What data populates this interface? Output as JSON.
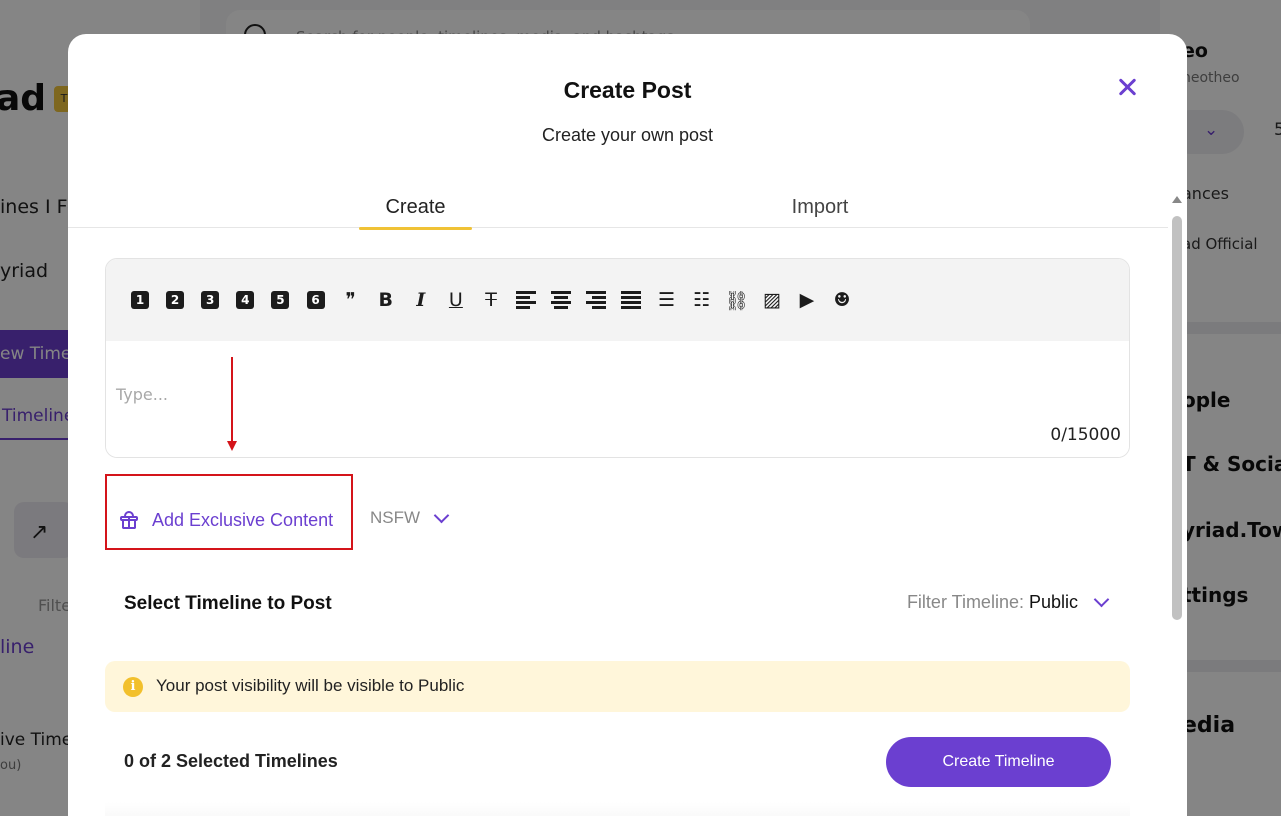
{
  "background": {
    "search_placeholder": "Search for people, timelines, media, and hashtags",
    "brand": "ad",
    "brand_badge": "T",
    "left_items": {
      "timelines_label": "ines I Fo",
      "myriad_label": "yriad",
      "new_timeline_button": "ew Time",
      "timeline_tab": "Timeline",
      "filter_label": "Filte",
      "line_label": "line",
      "exclusive_timeline": "ive Time",
      "you_label": "ou)"
    },
    "right_items": {
      "profile_name": "eo",
      "profile_handle": "neotheo",
      "balances": "ances",
      "official": "ad Official",
      "people": "ople",
      "social": "T & Social",
      "town": "yriad.Town",
      "settings": "ttings",
      "media": "edia",
      "count": "5"
    }
  },
  "modal": {
    "title": "Create Post",
    "subtitle": "Create your own post",
    "tabs": [
      {
        "label": "Create",
        "active": true
      },
      {
        "label": "Import",
        "active": false
      }
    ],
    "editor": {
      "toolbar": [
        {
          "name": "heading-1-icon",
          "glyph": "1",
          "kind": "box"
        },
        {
          "name": "heading-2-icon",
          "glyph": "2",
          "kind": "box"
        },
        {
          "name": "heading-3-icon",
          "glyph": "3",
          "kind": "box"
        },
        {
          "name": "heading-4-icon",
          "glyph": "4",
          "kind": "box"
        },
        {
          "name": "heading-5-icon",
          "glyph": "5",
          "kind": "box"
        },
        {
          "name": "heading-6-icon",
          "glyph": "6",
          "kind": "box"
        },
        {
          "name": "blockquote-icon",
          "glyph": "❞",
          "kind": "text"
        },
        {
          "name": "bold-icon",
          "glyph": "B",
          "kind": "text"
        },
        {
          "name": "italic-icon",
          "glyph": "I",
          "kind": "text"
        },
        {
          "name": "underline-icon",
          "glyph": "U",
          "kind": "text"
        },
        {
          "name": "strikethrough-icon",
          "glyph": "T",
          "kind": "text"
        },
        {
          "name": "align-left-icon",
          "glyph": "",
          "kind": "lines"
        },
        {
          "name": "align-center-icon",
          "glyph": "",
          "kind": "lines"
        },
        {
          "name": "align-right-icon",
          "glyph": "",
          "kind": "lines"
        },
        {
          "name": "align-justify-icon",
          "glyph": "",
          "kind": "lines"
        },
        {
          "name": "bulleted-list-icon",
          "glyph": "☰",
          "kind": "text"
        },
        {
          "name": "numbered-list-icon",
          "glyph": "☷",
          "kind": "text"
        },
        {
          "name": "link-icon",
          "glyph": "⛓",
          "kind": "text"
        },
        {
          "name": "image-icon",
          "glyph": "▨",
          "kind": "text"
        },
        {
          "name": "video-icon",
          "glyph": "▶",
          "kind": "text"
        },
        {
          "name": "emoji-icon",
          "glyph": "☻",
          "kind": "text"
        }
      ],
      "placeholder": "Type...",
      "counter": "0/15000"
    },
    "exclusive_content_label": "Add Exclusive Content",
    "nsfw_label": "NSFW",
    "select_timeline_title": "Select Timeline to Post",
    "filter_label": "Filter Timeline:",
    "filter_value": "Public",
    "notice_text": "Your post visibility will be visible to Public",
    "selected_count": "0 of 2 Selected Timelines",
    "create_timeline_button": "Create Timeline"
  },
  "colors": {
    "accent": "#6b3fd0",
    "tab_underline": "#f0c235",
    "notice_bg": "#fff6da",
    "annotation": "#d4141a"
  }
}
